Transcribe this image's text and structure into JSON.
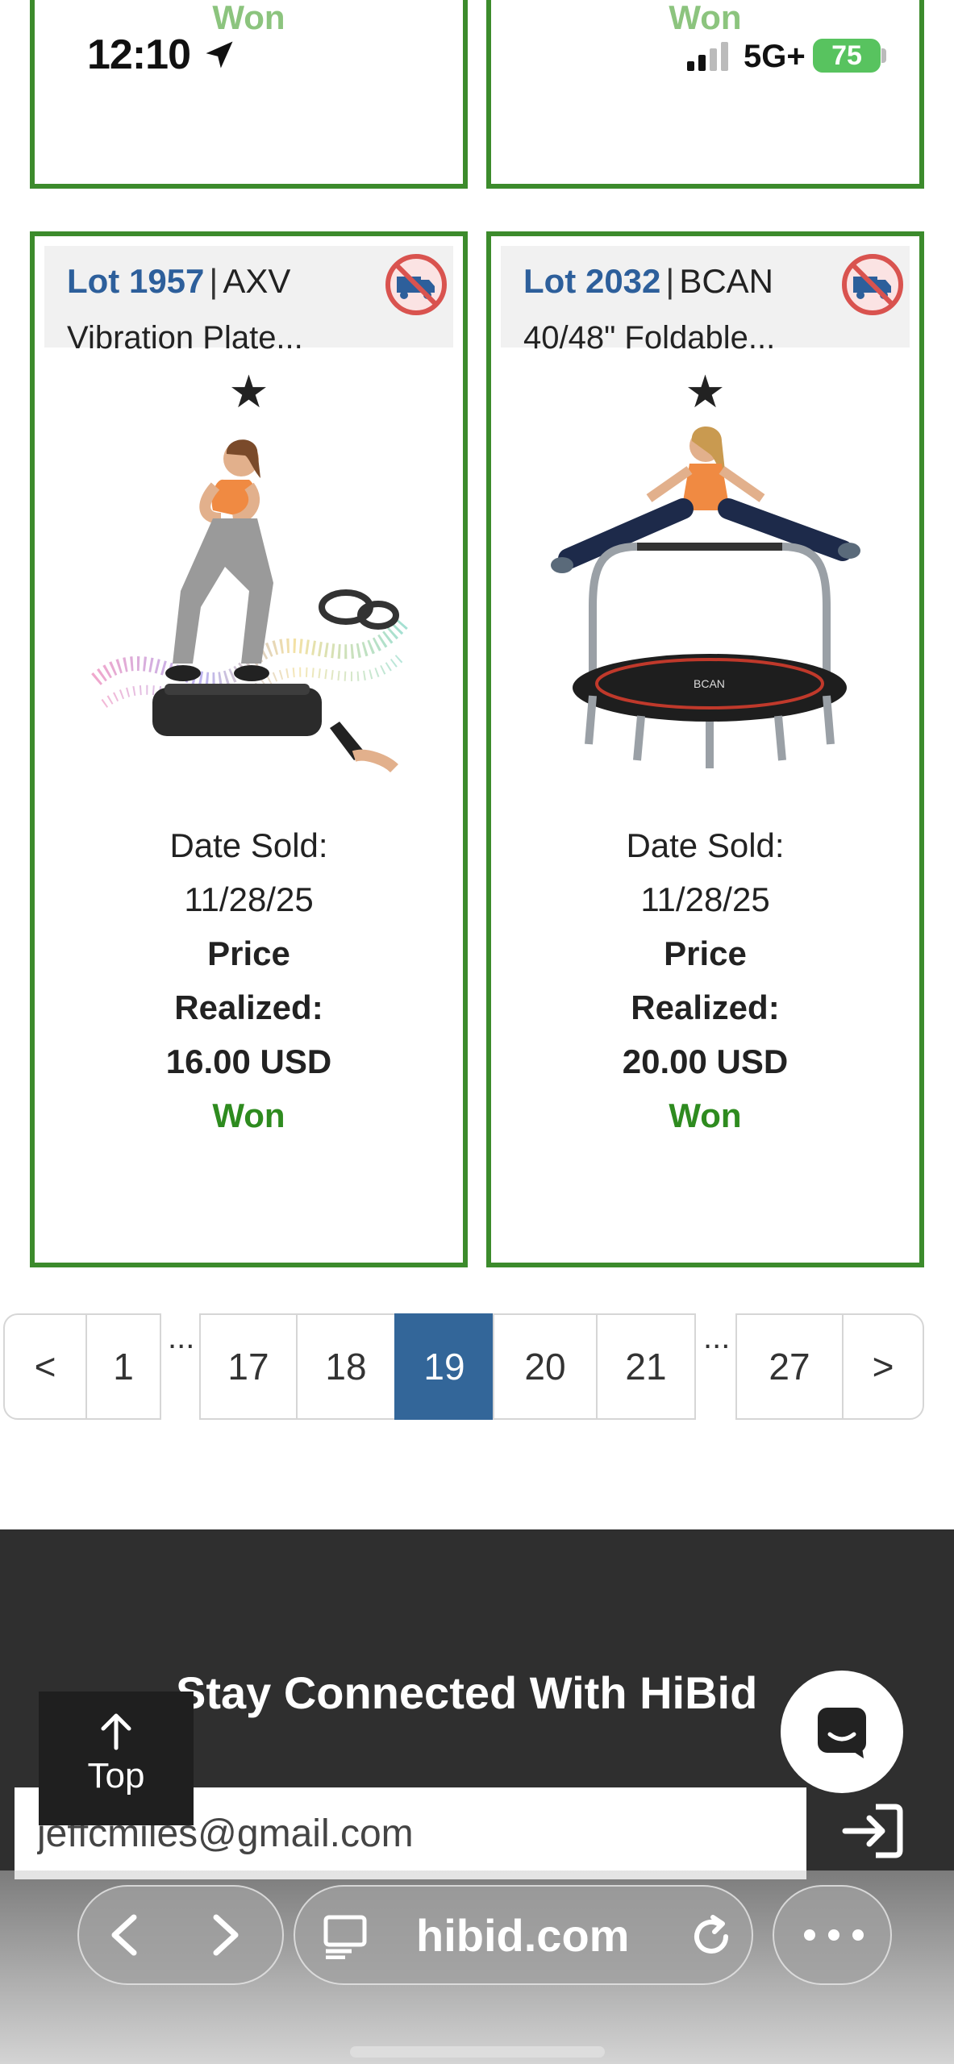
{
  "status_bar": {
    "time": "12:10",
    "network": "5G+",
    "battery": "75"
  },
  "top_cards": [
    {
      "status": "Won"
    },
    {
      "status": "Won"
    }
  ],
  "lots": [
    {
      "lot_label": "Lot 1957",
      "brand": "AXV",
      "title": "Vibration Plate...",
      "date_label": "Date Sold:",
      "date": "11/28/25",
      "price_label_1": "Price",
      "price_label_2": "Realized:",
      "price": "16.00 USD",
      "status": "Won"
    },
    {
      "lot_label": "Lot 2032",
      "brand": "BCAN",
      "title": "40/48\" Foldable...",
      "date_label": "Date Sold:",
      "date": "11/28/25",
      "price_label_1": "Price",
      "price_label_2": "Realized:",
      "price": "20.00 USD",
      "status": "Won"
    }
  ],
  "pagination": {
    "prev": "<",
    "next": ">",
    "ellipsis": "...",
    "pages": [
      "1",
      "17",
      "18",
      "19",
      "20",
      "21",
      "27"
    ],
    "current": "19"
  },
  "footer": {
    "title": "Stay Connected With HiBid",
    "email_value": "jeffcmiles@gmail.com"
  },
  "top_button": {
    "label": "Top"
  },
  "browser": {
    "url": "hibid.com"
  },
  "colors": {
    "accent_green": "#3c8b2c",
    "won_green": "#2e8b1f",
    "lot_blue": "#2d5f9b",
    "active_page": "#336699",
    "footer_bg": "#2f2f2f"
  }
}
